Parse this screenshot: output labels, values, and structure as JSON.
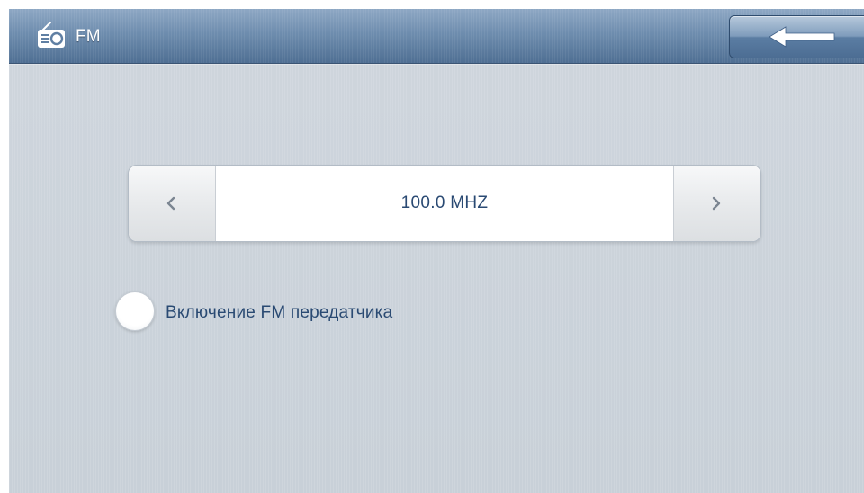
{
  "header": {
    "title": "FM",
    "icon": "radio-icon",
    "back_icon": "arrow-left-icon"
  },
  "frequency": {
    "value": "100.0 MHZ",
    "prev_label": "<",
    "next_label": ">"
  },
  "transmitter": {
    "label": "Включение FM передатчика",
    "checked": false
  },
  "colors": {
    "header": "#6e8dae",
    "background": "#cbd3db",
    "text": "#2a4a73",
    "accent_button": "#5b7da3"
  }
}
